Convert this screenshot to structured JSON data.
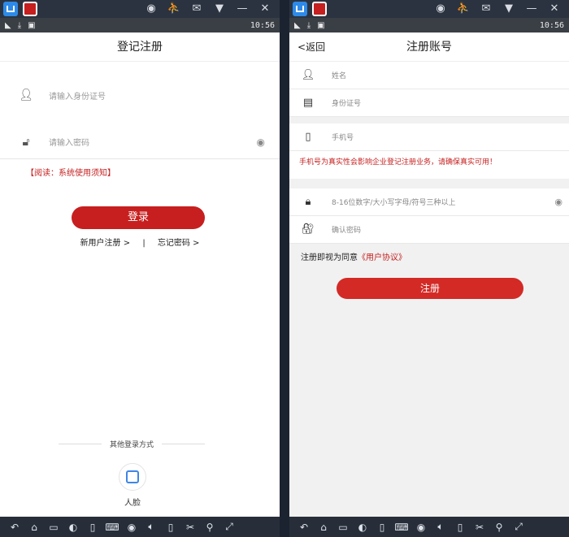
{
  "left": {
    "status_time": "10:56",
    "title": "登记注册",
    "id_placeholder": "请输入身份证号",
    "pwd_placeholder": "请输入密码",
    "notice": "【阅读：系统使用须知】",
    "login_label": "登录",
    "link_register": "新用户注册 >",
    "link_sep": "|",
    "link_forgot": "忘记密码 >",
    "other_login": "其他登录方式",
    "face_label": "人脸"
  },
  "right": {
    "status_time": "10:56",
    "back_label": "返回",
    "title": "注册账号",
    "name_placeholder": "姓名",
    "id_placeholder": "身份证号",
    "phone_placeholder": "手机号",
    "phone_warning": "手机号为真实性会影响企业登记注册业务，请确保真实可用！",
    "pwd_placeholder": "8-16位数字/大小写字母/符号三种以上",
    "confirm_placeholder": "确认密码",
    "agree_prefix": "注册即视为同意",
    "agree_link": "《用户协议》",
    "register_label": "注册"
  }
}
